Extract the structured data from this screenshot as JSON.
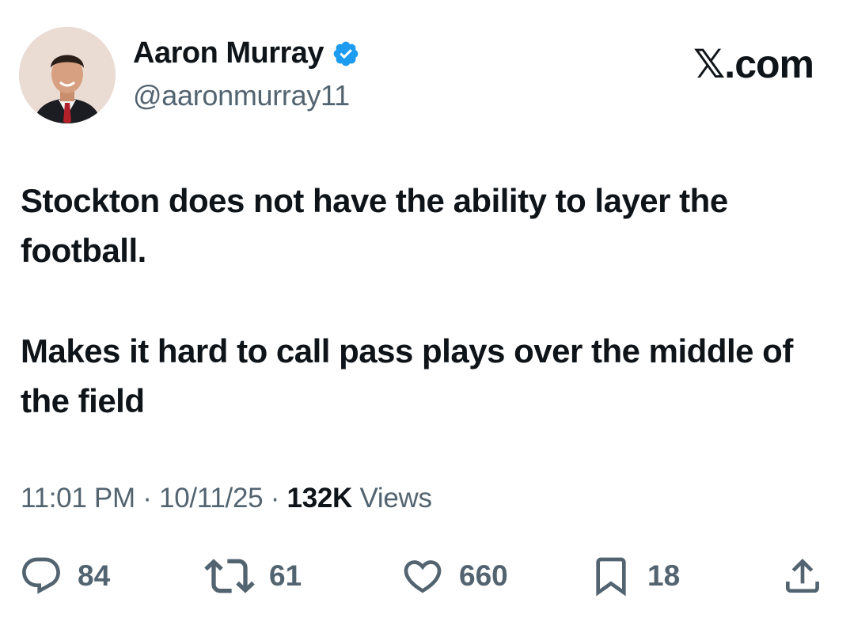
{
  "author": {
    "display_name": "Aaron Murray",
    "handle": "@aaronmurray11",
    "verified": true,
    "verified_color": "#1d9bf0"
  },
  "brand": {
    "label": "𝕏.com"
  },
  "tweet": {
    "paragraphs": [
      "Stockton does not have the ability to layer the football.",
      "Makes it hard to call pass plays over the middle of the field"
    ]
  },
  "meta": {
    "time": "11:01 PM",
    "separator": "·",
    "date": "10/11/25",
    "views_count": "132K",
    "views_label": "Views"
  },
  "actions": {
    "replies": {
      "icon": "reply-icon",
      "count": "84"
    },
    "reposts": {
      "icon": "repost-icon",
      "count": "61"
    },
    "likes": {
      "icon": "heart-icon",
      "count": "660"
    },
    "bookmarks": {
      "icon": "bookmark-icon",
      "count": "18"
    },
    "share": {
      "icon": "share-icon"
    }
  },
  "colors": {
    "text": "#0f1419",
    "secondary": "#536471",
    "background": "#ffffff"
  }
}
